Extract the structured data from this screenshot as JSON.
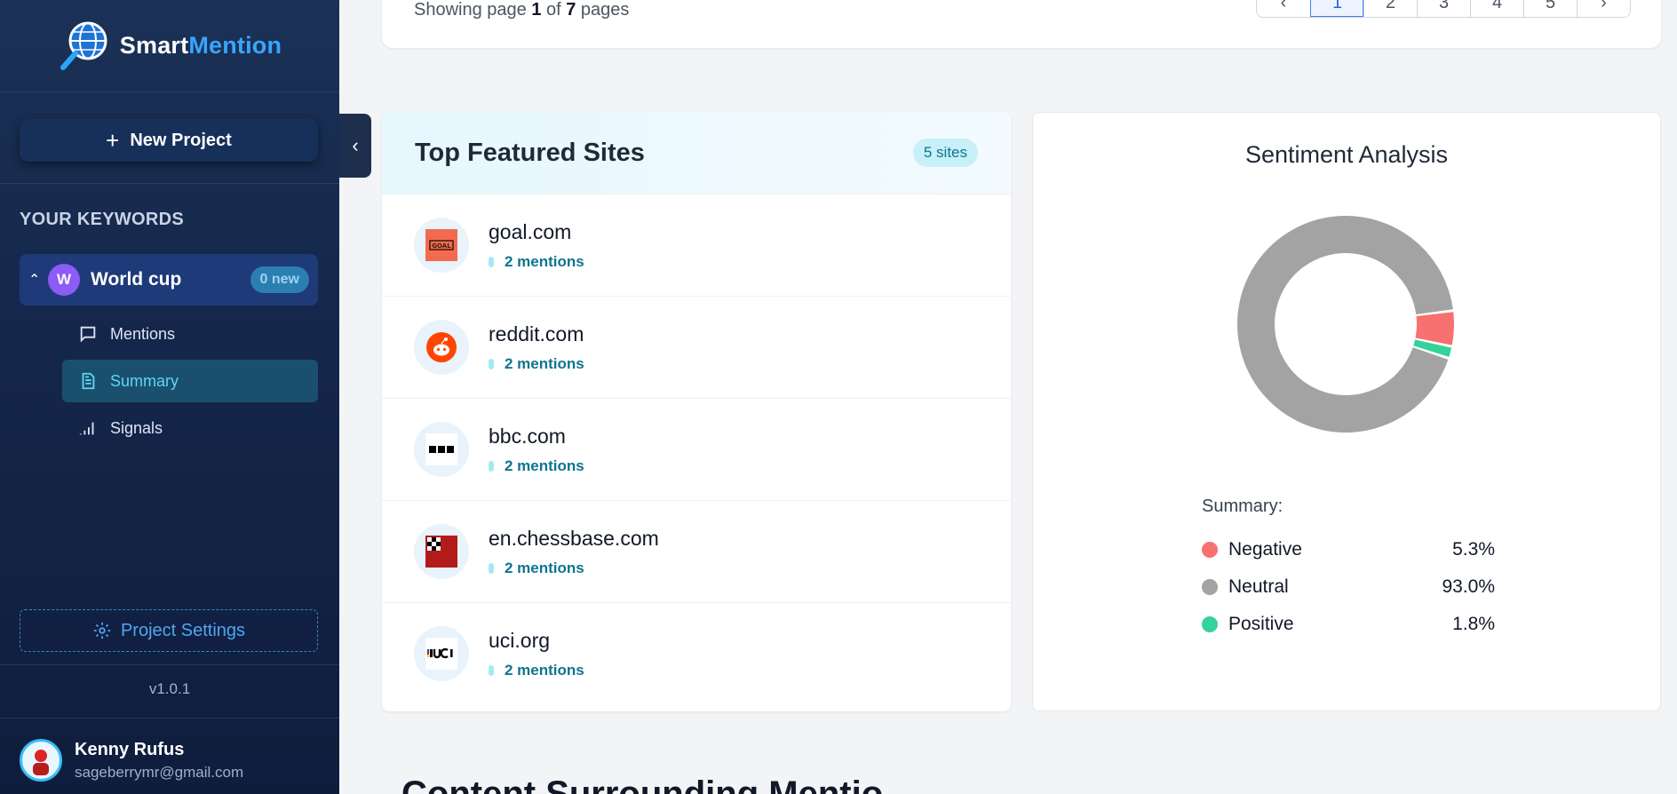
{
  "brand": {
    "name_part1": "Smart",
    "name_part2": "Mention"
  },
  "sidebar": {
    "new_project": "New Project",
    "keywords_heading": "YOUR KEYWORDS",
    "keyword": {
      "initial": "W",
      "name": "World cup",
      "badge": "0 new"
    },
    "sub_items": [
      "Mentions",
      "Summary",
      "Signals"
    ],
    "project_settings": "Project Settings",
    "version": "v1.0.1",
    "user": {
      "name": "Kenny Rufus",
      "email": "sageberrymr@gmail.com"
    }
  },
  "pagination": {
    "text_prefix": "Showing page ",
    "current": "1",
    "text_middle": " of ",
    "total": "7",
    "text_suffix": " pages",
    "pages": [
      "1",
      "2",
      "3",
      "4",
      "5"
    ],
    "prev_icon": "chevron-left-icon",
    "next_icon": "chevron-right-icon"
  },
  "featured": {
    "title": "Top Featured Sites",
    "count": "5 sites",
    "sites": [
      {
        "name": "goal.com",
        "mentions": "2 mentions",
        "icon": "goal-logo"
      },
      {
        "name": "reddit.com",
        "mentions": "2 mentions",
        "icon": "reddit-logo"
      },
      {
        "name": "bbc.com",
        "mentions": "2 mentions",
        "icon": "bbc-logo"
      },
      {
        "name": "en.chessbase.com",
        "mentions": "2 mentions",
        "icon": "chessbase-logo"
      },
      {
        "name": "uci.org",
        "mentions": "2 mentions",
        "icon": "uci-logo"
      }
    ]
  },
  "sentiment": {
    "title": "Sentiment Analysis",
    "summary_label": "Summary:",
    "items": [
      {
        "label": "Negative",
        "value": "5.3%",
        "color": "#f87171"
      },
      {
        "label": "Neutral",
        "value": "93.0%",
        "color": "#a3a3a3"
      },
      {
        "label": "Positive",
        "value": "1.8%",
        "color": "#34d399"
      }
    ]
  },
  "chart_data": {
    "type": "pie",
    "categories": [
      "Negative",
      "Neutral",
      "Positive"
    ],
    "values": [
      5.3,
      93.0,
      1.8
    ],
    "colors": [
      "#f87171",
      "#a3a3a3",
      "#34d399"
    ],
    "title": "Sentiment Analysis"
  },
  "bottom_heading": "Content Surrounding Mentio"
}
